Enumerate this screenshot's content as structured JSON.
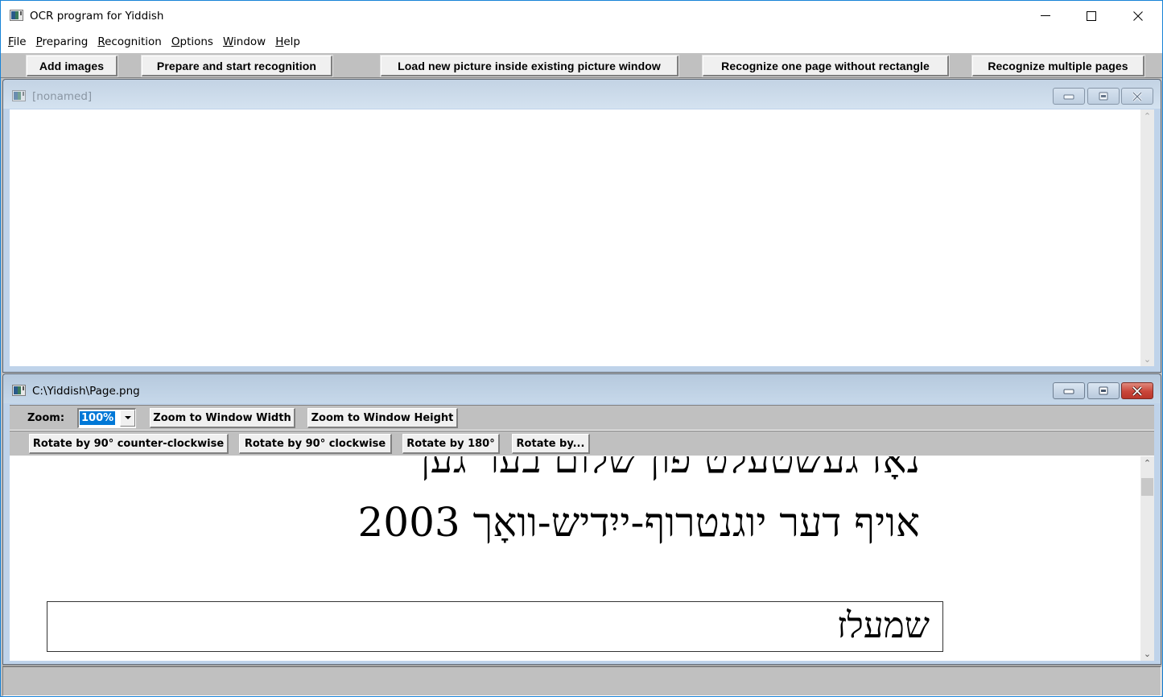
{
  "app": {
    "title": "OCR program for Yiddish",
    "window_controls": {
      "minimize": "minimize-icon",
      "maximize": "maximize-icon",
      "close": "close-icon"
    }
  },
  "menu": [
    {
      "label": "File",
      "mnemonic": "F",
      "rest": "ile"
    },
    {
      "label": "Preparing",
      "mnemonic": "P",
      "rest": "reparing"
    },
    {
      "label": "Recognition",
      "mnemonic": "R",
      "rest": "ecognition"
    },
    {
      "label": "Options",
      "mnemonic": "O",
      "rest": "ptions"
    },
    {
      "label": "Window",
      "mnemonic": "W",
      "rest": "indow"
    },
    {
      "label": "Help",
      "mnemonic": "H",
      "rest": "elp"
    }
  ],
  "toolbar": {
    "buttons": [
      {
        "label": "Add images"
      },
      {
        "label": "Prepare and start recognition"
      },
      {
        "label": "Load new picture inside existing picture window"
      },
      {
        "label": "Recognize one page without rectangle"
      },
      {
        "label": "Recognize multiple pages"
      }
    ]
  },
  "text_window": {
    "title": "[nonamed]",
    "state": "inactive",
    "content": ""
  },
  "image_window": {
    "title": "C:\\Yiddish\\Page.png",
    "state": "active",
    "zoom": {
      "label": "Zoom:",
      "value": "100%",
      "zoom_to_width": "Zoom to Window Width",
      "zoom_to_height": "Zoom to Window Height"
    },
    "rotate": {
      "ccw": "Rotate by 90° counter-clockwise",
      "cw": "Rotate by 90° clockwise",
      "r180": "Rotate by 180°",
      "custom": "Rotate by..."
    },
    "image_text": {
      "line1_partial": "נאָז געשטעלט פֿון שלום בער גען",
      "line2": "אויף דער יוגנטרוף-ייִדיש-וואָך 2003",
      "boxed_word": "שמעלז"
    },
    "scroll_position": 0.05
  },
  "statusbar": {
    "text": ""
  }
}
